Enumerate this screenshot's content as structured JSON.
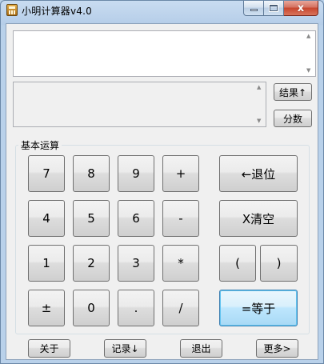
{
  "window": {
    "title": "小明计算器v4.0"
  },
  "caption": {
    "minimize": "",
    "maximize": "",
    "close": "x"
  },
  "display": {
    "input_value": "",
    "result_value": ""
  },
  "side_buttons": {
    "result": "结果↑",
    "fraction": "分数"
  },
  "group": {
    "label": "基本运算"
  },
  "keys": {
    "k7": "7",
    "k8": "8",
    "k9": "9",
    "plus": "+",
    "backspace": "←退位",
    "k4": "4",
    "k5": "5",
    "k6": "6",
    "minus": "-",
    "clear": "X清空",
    "k1": "1",
    "k2": "2",
    "k3": "3",
    "multiply": "*",
    "lparen": "(",
    "rparen": ")",
    "plusminus": "±",
    "k0": "0",
    "dot": ".",
    "divide": "/",
    "equals": "=等于"
  },
  "bottom": {
    "about": "关于",
    "record": "记录↓",
    "exit": "退出",
    "more": "更多>"
  }
}
